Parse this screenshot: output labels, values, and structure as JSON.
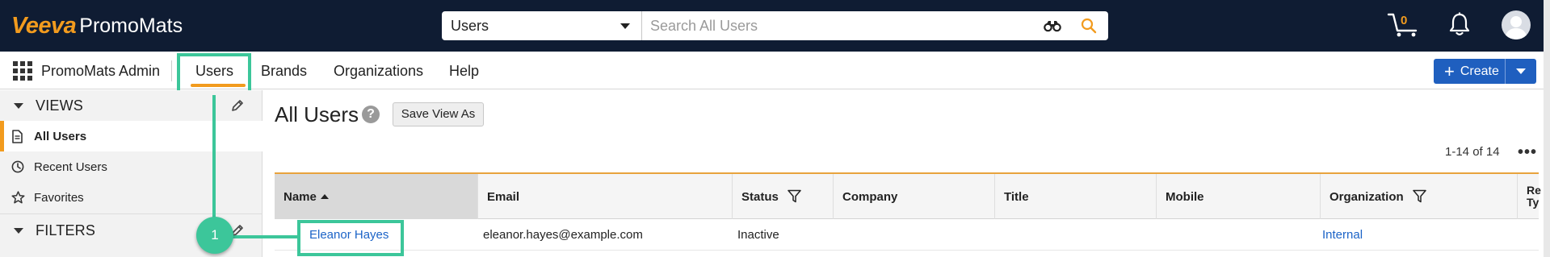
{
  "brand": {
    "logo_part1": "Veeva",
    "logo_part2": "PromoMats"
  },
  "search": {
    "scope": "Users",
    "placeholder": "Search All Users"
  },
  "header": {
    "cart_count": "0"
  },
  "nav": {
    "app_name": "PromoMats Admin",
    "tabs": [
      "Users",
      "Brands",
      "Organizations",
      "Help"
    ],
    "active_tab": "Users",
    "create_label": "Create"
  },
  "sidebar": {
    "views_label": "VIEWS",
    "items": [
      "All Users",
      "Recent Users",
      "Favorites"
    ],
    "active_item": "All Users",
    "filters_label": "FILTERS"
  },
  "main": {
    "title": "All Users",
    "help_glyph": "?",
    "save_view_label": "Save View As",
    "count": "1-14 of 14",
    "more_glyph": "•••",
    "columns": [
      "Name",
      "Email",
      "Status",
      "Company",
      "Title",
      "Mobile",
      "Organization",
      "Re\nTy"
    ],
    "rows": [
      {
        "name": "Eleanor Hayes",
        "email": "eleanor.hayes@example.com",
        "status": "Inactive",
        "company": "",
        "title": "",
        "mobile": "",
        "organization": "Internal"
      }
    ]
  },
  "annotation": {
    "badge": "1"
  },
  "colors": {
    "topbar": "#0f1c33",
    "accent_orange": "#f29b1e",
    "highlight_green": "#3cc69a",
    "link_blue": "#1b63c7",
    "create_blue": "#1f5fbf"
  }
}
